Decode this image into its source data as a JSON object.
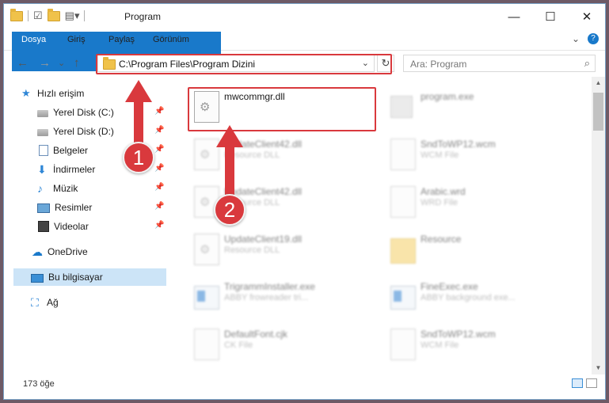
{
  "window": {
    "title": "Program",
    "qat_icons": [
      "folder-icon",
      "properties-icon",
      "new-folder-icon",
      "customize-icon"
    ],
    "controls": {
      "minimize": "—",
      "maximize": "☐",
      "close": "✕"
    }
  },
  "ribbon": {
    "tabs": [
      "Dosya",
      "Giriş",
      "Paylaş",
      "Görünüm"
    ],
    "expand": "⌄",
    "help": "?"
  },
  "navbar": {
    "back": "←",
    "forward": "→",
    "recent": "⌄",
    "up": "↑",
    "address": "C:\\Program Files\\Program Dizini",
    "address_dropdown": "⌄",
    "refresh": "↻",
    "search_placeholder": "Ara: Program",
    "search_icon": "⌕"
  },
  "sidebar": {
    "items": [
      {
        "label": "Hızlı erişim",
        "icon": "quick-access-icon",
        "pinned": false
      },
      {
        "label": "Yerel Disk (C:)",
        "icon": "disk-icon",
        "pinned": true
      },
      {
        "label": "Yerel Disk (D:)",
        "icon": "disk-icon",
        "pinned": true
      },
      {
        "label": "Belgeler",
        "icon": "documents-icon",
        "pinned": true
      },
      {
        "label": "İndirmeler",
        "icon": "downloads-icon",
        "pinned": true
      },
      {
        "label": "Müzik",
        "icon": "music-icon",
        "pinned": true
      },
      {
        "label": "Resimler",
        "icon": "pictures-icon",
        "pinned": true
      },
      {
        "label": "Videolar",
        "icon": "videos-icon",
        "pinned": true
      },
      {
        "label": "OneDrive",
        "icon": "onedrive-icon",
        "pinned": false
      },
      {
        "label": "Bu bilgisayar",
        "icon": "this-pc-icon",
        "pinned": false,
        "selected": true
      },
      {
        "label": "Ağ",
        "icon": "network-icon",
        "pinned": false
      }
    ],
    "pin_glyph": "📌"
  },
  "files": [
    {
      "name": "mwcommgr.dll",
      "desc": "",
      "icon": "dll-file-icon"
    },
    {
      "name": "program.exe",
      "desc": "",
      "icon": "exe-file-icon"
    },
    {
      "name": "UpdateClient42.dll",
      "desc": "Resource DLL",
      "icon": "dll-file-icon"
    },
    {
      "name": "SndToWP12.wcm",
      "desc": "WCM File",
      "icon": "blank-file-icon"
    },
    {
      "name": "UpdateClient42.dll",
      "desc": "Resource DLL",
      "icon": "dll-file-icon"
    },
    {
      "name": "Arabic.wrd",
      "desc": "WRD File",
      "icon": "blank-file-icon"
    },
    {
      "name": "UpdateClient19.dll",
      "desc": "Resource DLL",
      "icon": "dll-file-icon"
    },
    {
      "name": "Resource",
      "desc": "",
      "icon": "folder-icon"
    },
    {
      "name": "TrigrammInstaller.exe",
      "desc": "ABBY frowreader tri...",
      "icon": "app-file-icon"
    },
    {
      "name": "FineExec.exe",
      "desc": "ABBY background exe...",
      "icon": "app-file-icon"
    },
    {
      "name": "DefaultFont.cjk",
      "desc": "CK File",
      "icon": "blank-file-icon"
    },
    {
      "name": "SndToWP12.wcm",
      "desc": "WCM File",
      "icon": "blank-file-icon"
    }
  ],
  "scrollbar": {
    "up": "▲",
    "down": "▼"
  },
  "status": {
    "count": "173 öğe"
  },
  "annotations": {
    "step1": "1",
    "step2": "2"
  },
  "colors": {
    "accent": "#1979ca",
    "highlight": "#d9393d",
    "selected": "#cce4f7"
  }
}
